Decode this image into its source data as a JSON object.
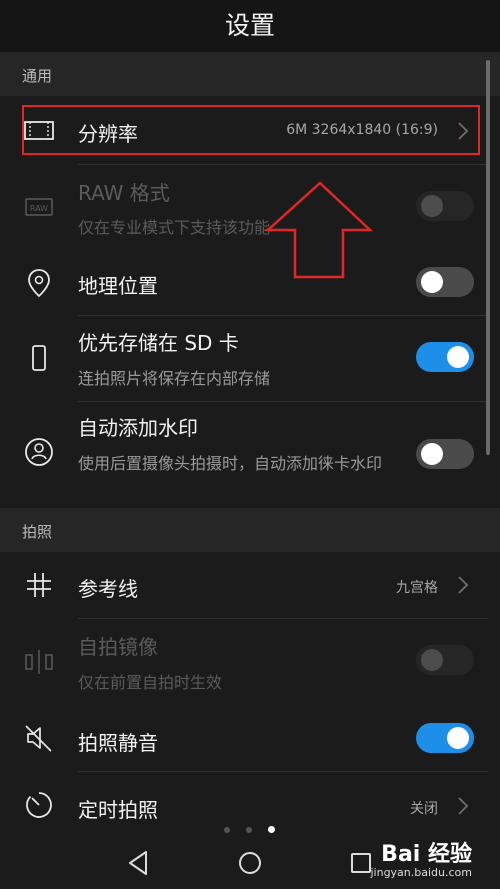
{
  "header": {
    "title": "设置"
  },
  "sections": {
    "general": "通用",
    "photo": "拍照"
  },
  "rows": {
    "resolution": {
      "title": "分辨率",
      "value": "6M 3264x1840 (16:9)"
    },
    "raw": {
      "title": "RAW 格式",
      "subtitle": "仅在专业模式下支持该功能",
      "toggle": "off",
      "enabled": false
    },
    "location": {
      "title": "地理位置",
      "toggle": "off"
    },
    "sd": {
      "title": "优先存储在 SD 卡",
      "subtitle": "连拍照片将保存在内部存储",
      "toggle": "on"
    },
    "watermark": {
      "title": "自动添加水印",
      "subtitle": "使用后置摄像头拍摄时，自动添加徕卡水印",
      "toggle": "off"
    },
    "gridlines": {
      "title": "参考线",
      "value": "九宫格"
    },
    "mirror": {
      "title": "自拍镜像",
      "subtitle": "仅在前置自拍时生效",
      "toggle": "off",
      "enabled": false
    },
    "mute": {
      "title": "拍照静音",
      "toggle": "on"
    },
    "timer": {
      "title": "定时拍照",
      "value": "关闭"
    }
  },
  "icons": {
    "resolution": "aspect-ratio-icon",
    "raw": "raw-icon",
    "location": "location-pin-icon",
    "sd": "phone-storage-icon",
    "watermark": "portrait-stamp-icon",
    "gridlines": "grid-icon",
    "mirror": "mirror-icon",
    "mute": "speaker-muted-icon",
    "timer": "timer-icon"
  },
  "colors": {
    "accent": "#1e8fe8",
    "annotation": "#e12626",
    "background": "#1b1b1b"
  },
  "page_indicator": {
    "pages": 3,
    "current": 3
  },
  "watermark": {
    "brand": "Bai 经验",
    "site": "jingyan.baidu.com"
  }
}
